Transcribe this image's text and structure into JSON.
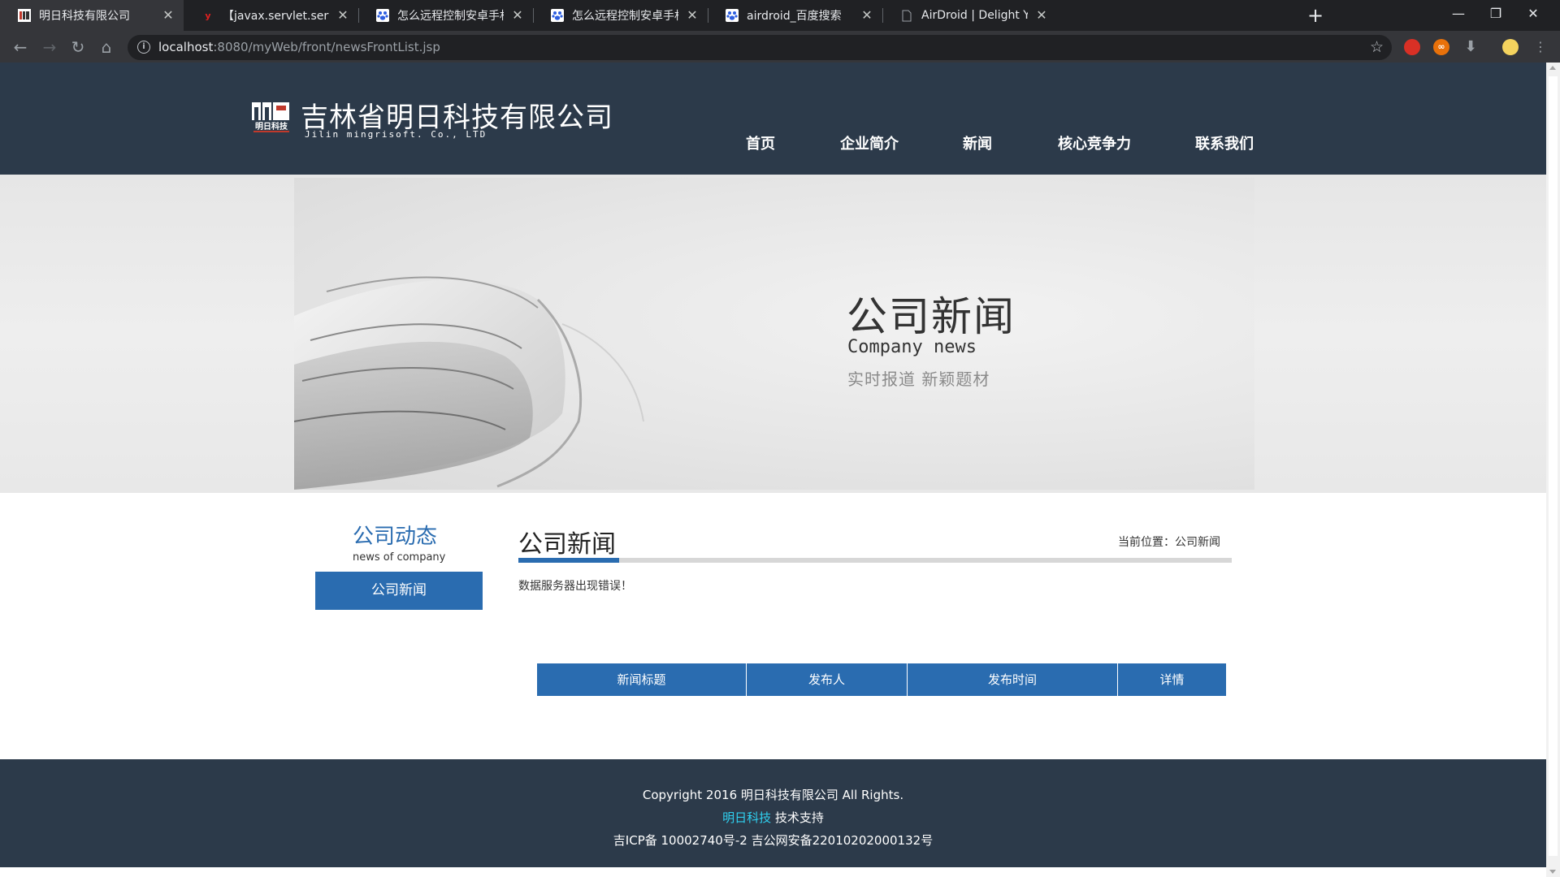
{
  "browser": {
    "tabs": [
      {
        "label": "明日科技有限公司",
        "active": true
      },
      {
        "label": "【javax.servlet.servletexceptio",
        "active": false
      },
      {
        "label": "怎么远程控制安卓手机_百度搜索",
        "active": false
      },
      {
        "label": "怎么远程控制安卓手机，控制安卓",
        "active": false
      },
      {
        "label": "airdroid_百度搜索",
        "active": false
      },
      {
        "label": "AirDroid | Delight Your Multi-S",
        "active": false
      }
    ],
    "tab_close_glyph": "✕",
    "new_tab_glyph": "+",
    "url_host": "localhost",
    "url_rest": ":8080/myWeb/front/newsFrontList.jsp",
    "window_controls": [
      "—",
      "❐",
      "✕"
    ]
  },
  "site": {
    "logo_text": "明日科技",
    "company_cn": "吉林省明日科技有限公司",
    "company_en": "Jilin mingrisoft. Co., LTD",
    "nav": [
      "首页",
      "企业简介",
      "新闻",
      "核心竞争力",
      "联系我们"
    ]
  },
  "banner": {
    "title": "公司新闻",
    "subtitle": "Company news",
    "tagline": "实时报道  新颖题材"
  },
  "sidebar": {
    "title": "公司动态",
    "subtitle": "news of company",
    "button": "公司新闻"
  },
  "main": {
    "title": "公司新闻",
    "breadcrumb_label": "当前位置：",
    "breadcrumb_value": "公司新闻",
    "error": "数据服务器出现错误！",
    "table_headers": [
      "新闻标题",
      "发布人",
      "发布时间",
      "详情"
    ]
  },
  "footer": {
    "line1": "Copyright 2016 明日科技有限公司 All Rights.",
    "line2_accent": "明日科技",
    "line2_rest": " 技术支持",
    "line3": "吉ICP备 10002740号-2 吉公网安备22010202000132号"
  },
  "colors": {
    "header_bg": "#2c3a4a",
    "accent_blue": "#2a6cb0",
    "footer_accent": "#2fd0f0"
  }
}
